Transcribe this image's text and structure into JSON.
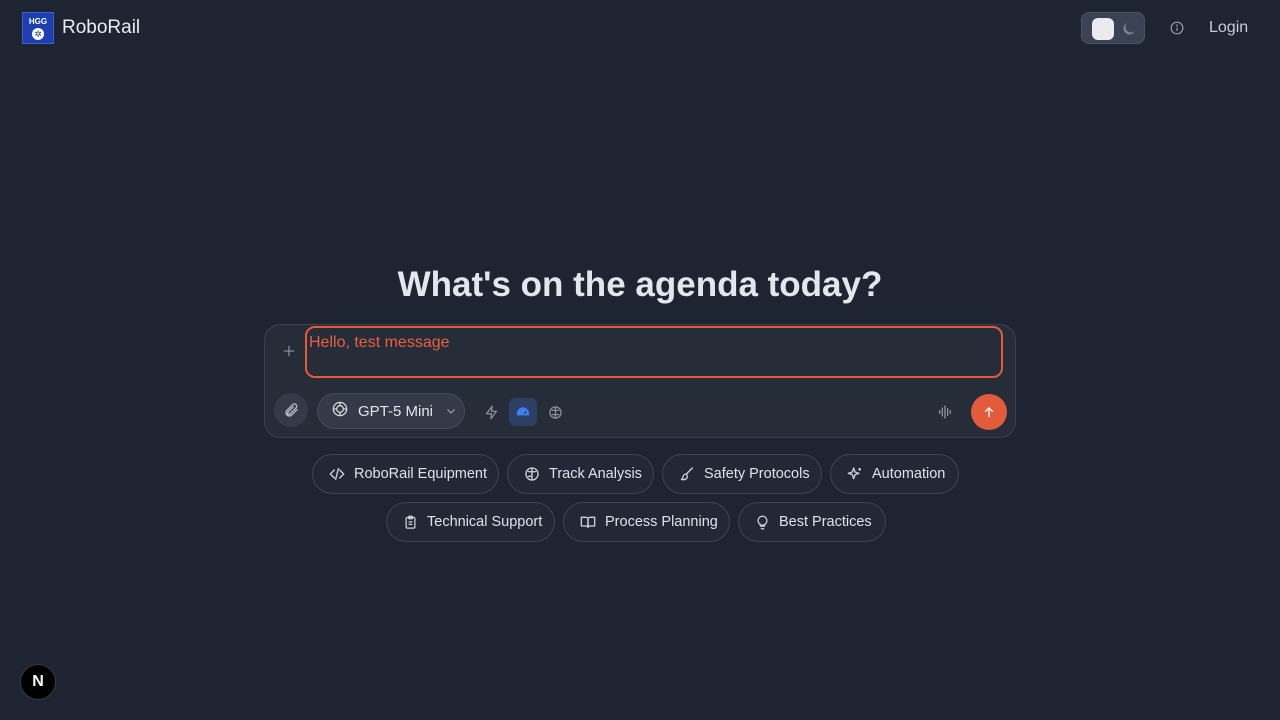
{
  "header": {
    "logo_text": "HGG",
    "brand": "RoboRail",
    "login_label": "Login"
  },
  "main": {
    "headline": "What's on the agenda today?"
  },
  "composer": {
    "message_value": "Hello, test message",
    "model_label": "GPT-5 Mini"
  },
  "suggestions": [
    {
      "label": "RoboRail Equipment",
      "icon": "code-icon"
    },
    {
      "label": "Track Analysis",
      "icon": "brain-icon"
    },
    {
      "label": "Safety Protocols",
      "icon": "brush-icon"
    },
    {
      "label": "Automation",
      "icon": "sparkles-icon"
    },
    {
      "label": "Technical Support",
      "icon": "clipboard-icon"
    },
    {
      "label": "Process Planning",
      "icon": "book-icon"
    },
    {
      "label": "Best Practices",
      "icon": "lightbulb-icon"
    }
  ],
  "footer": {
    "dev_badge": "N"
  },
  "colors": {
    "background": "#1f2433",
    "accent": "#e25b3a",
    "active_tool": "#3b82f6"
  }
}
